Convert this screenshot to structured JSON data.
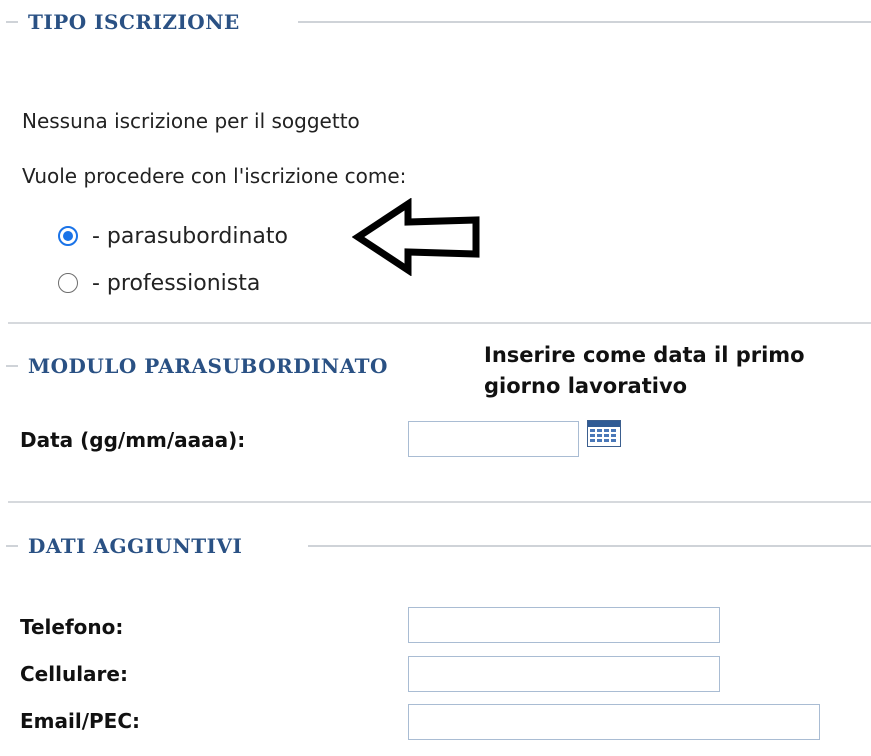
{
  "sections": {
    "tipo_iscrizione": {
      "title": "TIPO ISCRIZIONE",
      "no_registration": "Nessuna iscrizione per il soggetto",
      "question": "Vuole procedere con l'iscrizione come:",
      "options": [
        {
          "label": "- parasubordinato",
          "selected": true
        },
        {
          "label": "- professionista",
          "selected": false
        }
      ]
    },
    "modulo_parasubordinato": {
      "title": "MODULO PARASUBORDINATO",
      "note": "Inserire come data il primo giorno lavorativo",
      "date_label": "Data (gg/mm/aaaa):",
      "date_value": "",
      "calendar_icon": "calendar-icon"
    },
    "dati_aggiuntivi": {
      "title": "DATI AGGIUNTIVI",
      "fields": [
        {
          "label": "Telefono:",
          "value": ""
        },
        {
          "label": "Cellulare:",
          "value": ""
        },
        {
          "label": "Email/PEC:",
          "value": ""
        }
      ]
    }
  },
  "annotation": {
    "arrow_icon": "left-arrow-icon"
  },
  "colors": {
    "heading": "#2a5184",
    "radio_accent": "#1a73e8",
    "input_border": "#a9bcd3"
  }
}
